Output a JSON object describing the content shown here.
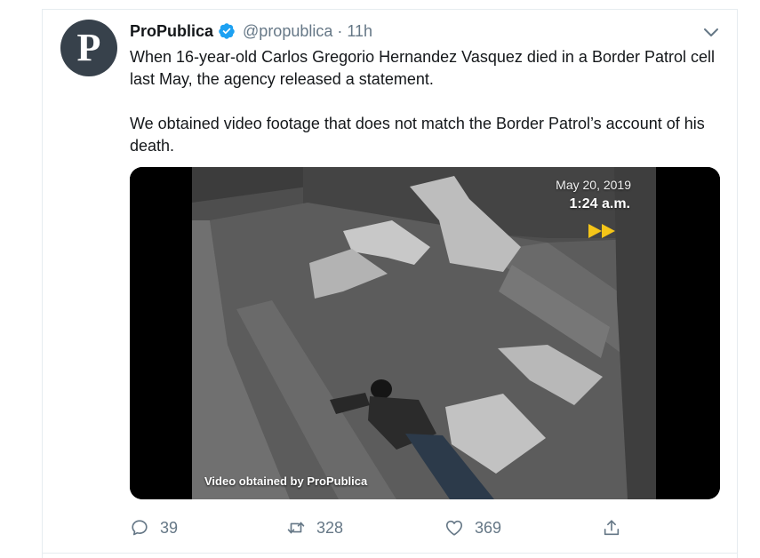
{
  "tweet": {
    "display_name": "ProPublica",
    "handle": "@propublica",
    "separator": "·",
    "time": "11h",
    "avatar_letter": "P",
    "text_p1": "When 16-year-old Carlos Gregorio Hernandez Vasquez died in a Border Patrol cell last May, the agency released a statement.",
    "text_p2": "We obtained video footage that does not match the Border Patrol’s account of his death."
  },
  "video": {
    "date": "May 20, 2019",
    "time": "1:24 a.m.",
    "credit": "Video obtained by ProPublica"
  },
  "actions": {
    "reply_count": "39",
    "retweet_count": "328",
    "like_count": "369"
  },
  "icons": {
    "verified": "verified-badge-icon",
    "caret": "chevron-down-icon",
    "reply": "reply-icon",
    "retweet": "retweet-icon",
    "like": "heart-icon",
    "share": "share-icon",
    "fast_forward": "fast-forward-icon"
  },
  "colors": {
    "verified": "#1da1f2",
    "secondary_text": "#657786",
    "primary_text": "#14171a",
    "fast_forward": "#f5c518"
  }
}
